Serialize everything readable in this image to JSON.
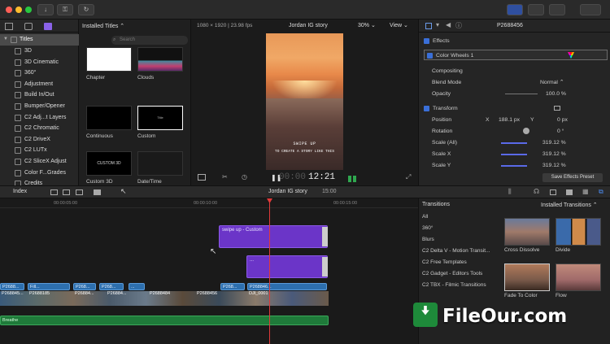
{
  "toolbar": {
    "buttons": [
      "↓",
      "⚿",
      "↻"
    ]
  },
  "sidebar": {
    "root": "Titles",
    "items": [
      "3D",
      "3D Cinematic",
      "360°",
      "Adjustment",
      "Build In/Out",
      "Bumper/Opener",
      "C2 Adj...t Layers",
      "C2 Chromatic",
      "C2 DriveX",
      "C2 LUTx",
      "C2 SliceX Adjust",
      "Color F...Grades",
      "Credits"
    ]
  },
  "browser": {
    "title": "Installed Titles ⌃",
    "search_placeholder": "Search",
    "tiles": [
      {
        "label": "Chapter",
        "text": ""
      },
      {
        "label": "Clouds",
        "text": ""
      },
      {
        "label": "Continuous",
        "text": ""
      },
      {
        "label": "Custom",
        "text": "Title"
      },
      {
        "label": "Custom 3D",
        "text": "CUSTOM 3D"
      },
      {
        "label": "Date/Time",
        "text": ""
      }
    ]
  },
  "viewer": {
    "format": "1080 × 1920 | 23.98 fps",
    "project": "Jordan IG story",
    "zoom": "30%",
    "view": "View",
    "overlay_line1": "SWIPE UP",
    "overlay_line2": "TO CREATE A STORY LIKE THIS",
    "timecode_dim": "00:00",
    "timecode": "12:21"
  },
  "inspector": {
    "clip_name": "P2688456",
    "effects_header": "Effects",
    "effect_name": "Color Wheels 1",
    "compositing": "Compositing",
    "blend_mode_label": "Blend Mode",
    "blend_mode_value": "Normal ⌃",
    "opacity_label": "Opacity",
    "opacity_value": "100.0 %",
    "transform": "Transform",
    "position_label": "Position",
    "position_x_label": "X",
    "position_x": "188.1 px",
    "position_y_label": "Y",
    "position_y": "0 px",
    "rotation_label": "Rotation",
    "rotation_value": "0 °",
    "scale_all_label": "Scale (All)",
    "scale_all": "319.12 %",
    "scale_x_label": "Scale X",
    "scale_x": "319.12 %",
    "scale_y_label": "Scale Y",
    "scale_y": "319.12 %",
    "save_preset": "Save Effects Preset"
  },
  "timeline": {
    "index": "Index",
    "project": "Jordan IG story",
    "duration": "15:00",
    "ruler": [
      "00:00:05:00",
      "00:00:10:00",
      "00:00:15:00"
    ],
    "title_clip": "swipe up - Custom",
    "title_clip2": "...",
    "audio": "Breathe",
    "blue_top": [
      "P2688...",
      "Fill...",
      "P268...",
      "P268...",
      "...",
      "P268...",
      "P268846..."
    ],
    "blue_bottom": [
      "P268845...",
      "P2688185",
      "P26884...",
      "P26884...",
      "P2688484",
      "P2688456",
      "DJI_0001"
    ]
  },
  "transitions": {
    "header": "Transitions",
    "installed": "Installed Transitions ⌃",
    "categories": [
      "All",
      "360°",
      "Blurs",
      "C2 Delta V - Motion Transit...",
      "C2 Free Templates",
      "C2 Gadget - Editors Tools",
      "C2 TBX - Filmic Transitions"
    ],
    "tiles": [
      "Cross Dissolve",
      "Divide",
      "Fade To Color",
      "Flow"
    ]
  },
  "watermark": "FileOur.com",
  "colors": {
    "accent": "#3a6fd8",
    "title_clip": "#6b35c8",
    "video_clip": "#2d6fae",
    "audio_clip": "#1f7a3a",
    "playhead": "#e03a3a"
  }
}
